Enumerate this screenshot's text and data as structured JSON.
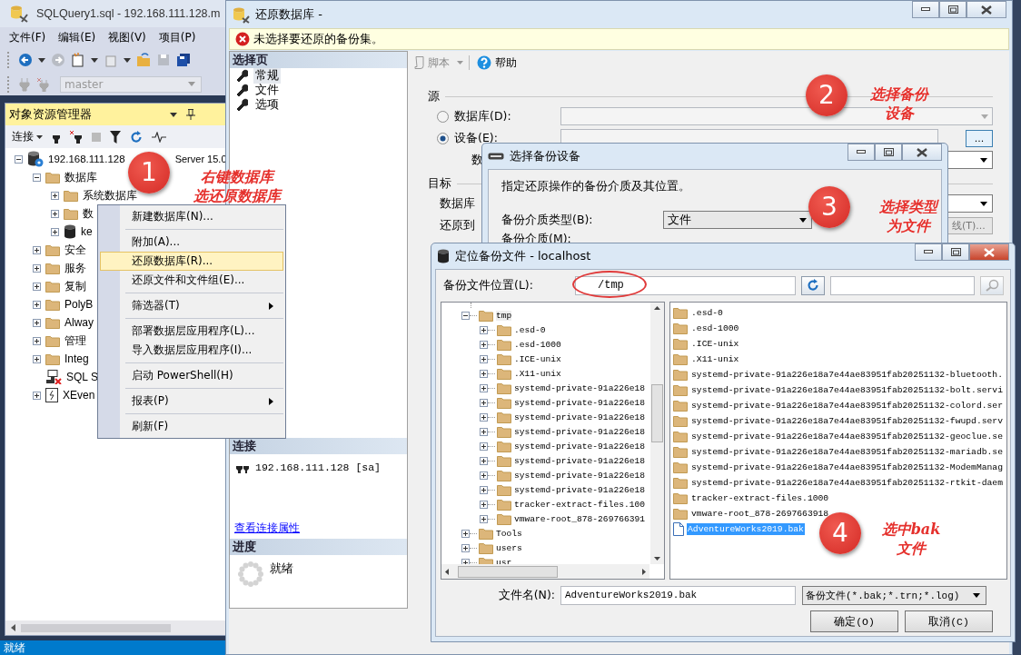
{
  "main_window": {
    "title": "SQLQuery1.sql - 192.168.111.128.m",
    "menu": [
      "文件(F)",
      "编辑(E)",
      "视图(V)",
      "项目(P)"
    ],
    "database_selector": {
      "value": "master",
      "disabled": true
    },
    "status_bar": "就绪"
  },
  "object_explorer": {
    "title": "对象资源管理器",
    "connect_label": "连接",
    "tree": [
      {
        "label": "192.168.111.128",
        "suffix": "Server 15.0",
        "kind": "server",
        "expanded": true,
        "children": [
          {
            "label": "数据库",
            "kind": "folder",
            "expanded": true,
            "children": [
              {
                "label": "系统数据库",
                "kind": "folder",
                "expanded": false
              },
              {
                "label": "数",
                "kind": "folder",
                "expanded": false
              },
              {
                "label": "ke",
                "kind": "database",
                "expanded": false
              }
            ]
          },
          {
            "label": "安全",
            "kind": "folder",
            "expanded": false
          },
          {
            "label": "服务",
            "kind": "folder",
            "expanded": false
          },
          {
            "label": "复制",
            "kind": "folder",
            "expanded": false
          },
          {
            "label": "PolyB",
            "kind": "folder",
            "expanded": false
          },
          {
            "label": "Alway",
            "kind": "folder",
            "expanded": false
          },
          {
            "label": "管理",
            "kind": "folder",
            "expanded": false
          },
          {
            "label": "Integ",
            "kind": "folder",
            "expanded": false
          },
          {
            "label": "SQL S",
            "kind": "agent"
          },
          {
            "label": "XEven",
            "kind": "xevent",
            "expanded": false
          }
        ]
      }
    ]
  },
  "context_menu": {
    "groups": [
      [
        {
          "label": "新建数据库(N)...",
          "kind": "command",
          "selected": false
        }
      ],
      [
        {
          "label": "附加(A)...",
          "kind": "command",
          "selected": false
        },
        {
          "label": "还原数据库(R)...",
          "kind": "command",
          "selected": true
        },
        {
          "label": "还原文件和文件组(E)...",
          "kind": "command",
          "selected": false
        }
      ],
      [
        {
          "label": "筛选器(T)",
          "kind": "submenu",
          "selected": false
        }
      ],
      [
        {
          "label": "部署数据层应用程序(L)...",
          "kind": "command",
          "selected": false
        },
        {
          "label": "导入数据层应用程序(I)...",
          "kind": "command",
          "selected": false
        }
      ],
      [
        {
          "label": "启动 PowerShell(H)",
          "kind": "command",
          "selected": false
        }
      ],
      [
        {
          "label": "报表(P)",
          "kind": "submenu",
          "selected": false
        }
      ],
      [
        {
          "label": "刷新(F)",
          "kind": "command",
          "selected": false
        }
      ]
    ]
  },
  "restore_dialog": {
    "title": "还原数据库 -",
    "warning": "未选择要还原的备份集。",
    "pages_header": "选择页",
    "pages": [
      {
        "label": "常规",
        "selected": true
      },
      {
        "label": "文件",
        "selected": false
      },
      {
        "label": "选项",
        "selected": false
      }
    ],
    "connection_header": "连接",
    "connection": "192.168.111.128 [sa]",
    "connection_link": "查看连接属性",
    "progress_header": "进度",
    "progress_status": "就绪",
    "toolbar": {
      "script": "脚本",
      "help": "帮助"
    },
    "source": {
      "title": "源",
      "options": [
        {
          "label": "数据库(D):",
          "selected": false
        },
        {
          "label": "设备(E):",
          "selected": true
        }
      ],
      "browse_button": "...",
      "database_label": "数"
    },
    "target": {
      "title": "目标",
      "database_label": "数据库",
      "restore_to_label": "还原到",
      "timeline_button": "线(T)..."
    }
  },
  "device_dialog": {
    "title": "选择备份设备",
    "description": "指定还原操作的备份介质及其位置。",
    "media_type_label": "备份介质类型(B):",
    "media_type": "文件",
    "media_label": "备份介质(M):"
  },
  "locate_dialog": {
    "title": "定位备份文件 - localhost",
    "location_label": "备份文件位置(L):",
    "location": "/tmp",
    "folder_tree": [
      {
        "label": "tmp",
        "expanded": true,
        "selected": true,
        "children": [
          {
            "label": ".esd-0",
            "expanded": false,
            "selected": false
          },
          {
            "label": ".esd-1000",
            "expanded": false,
            "selected": false
          },
          {
            "label": ".ICE-unix",
            "expanded": false,
            "selected": false
          },
          {
            "label": ".X11-unix",
            "expanded": false,
            "selected": false
          },
          {
            "label": "systemd-private-91a226e18",
            "expanded": false,
            "selected": false
          },
          {
            "label": "systemd-private-91a226e18",
            "expanded": false,
            "selected": false
          },
          {
            "label": "systemd-private-91a226e18",
            "expanded": false,
            "selected": false
          },
          {
            "label": "systemd-private-91a226e18",
            "expanded": false,
            "selected": false
          },
          {
            "label": "systemd-private-91a226e18",
            "expanded": false,
            "selected": false
          },
          {
            "label": "systemd-private-91a226e18",
            "expanded": false,
            "selected": false
          },
          {
            "label": "systemd-private-91a226e18",
            "expanded": false,
            "selected": false
          },
          {
            "label": "systemd-private-91a226e18",
            "expanded": false,
            "selected": false
          },
          {
            "label": "tracker-extract-files.100",
            "expanded": false,
            "selected": false
          },
          {
            "label": "vmware-root_878-269766391",
            "expanded": false,
            "selected": false
          }
        ]
      },
      {
        "label": "Tools",
        "expanded": false,
        "selected": false
      },
      {
        "label": "users",
        "expanded": false,
        "selected": false
      },
      {
        "label": "usr",
        "expanded": false,
        "selected": false
      }
    ],
    "files": [
      {
        "name": ".esd-0",
        "kind": "folder",
        "selected": false
      },
      {
        "name": ".esd-1000",
        "kind": "folder",
        "selected": false
      },
      {
        "name": ".ICE-unix",
        "kind": "folder",
        "selected": false
      },
      {
        "name": ".X11-unix",
        "kind": "folder",
        "selected": false
      },
      {
        "name": "systemd-private-91a226e18a7e44ae83951fab20251132-bluetooth.",
        "kind": "folder",
        "selected": false
      },
      {
        "name": "systemd-private-91a226e18a7e44ae83951fab20251132-bolt.servi",
        "kind": "folder",
        "selected": false
      },
      {
        "name": "systemd-private-91a226e18a7e44ae83951fab20251132-colord.ser",
        "kind": "folder",
        "selected": false
      },
      {
        "name": "systemd-private-91a226e18a7e44ae83951fab20251132-fwupd.serv",
        "kind": "folder",
        "selected": false
      },
      {
        "name": "systemd-private-91a226e18a7e44ae83951fab20251132-geoclue.se",
        "kind": "folder",
        "selected": false
      },
      {
        "name": "systemd-private-91a226e18a7e44ae83951fab20251132-mariadb.se",
        "kind": "folder",
        "selected": false
      },
      {
        "name": "systemd-private-91a226e18a7e44ae83951fab20251132-ModemManag",
        "kind": "folder",
        "selected": false
      },
      {
        "name": "systemd-private-91a226e18a7e44ae83951fab20251132-rtkit-daem",
        "kind": "folder",
        "selected": false
      },
      {
        "name": "tracker-extract-files.1000",
        "kind": "folder",
        "selected": false
      },
      {
        "name": "vmware-root_878-2697663918",
        "kind": "folder",
        "selected": false
      },
      {
        "name": "AdventureWorks2019.bak",
        "kind": "file",
        "selected": true
      }
    ],
    "file_name_label": "文件名(N):",
    "file_name": "AdventureWorks2019.bak",
    "file_type": "备份文件(*.bak;*.trn;*.log)",
    "buttons": [
      "确定(O)",
      "取消(C)"
    ]
  },
  "annotations": [
    {
      "number": "1",
      "lines": [
        "右键数据库",
        "选还原数据库"
      ]
    },
    {
      "number": "2",
      "lines": [
        "选择备份",
        "设备"
      ]
    },
    {
      "number": "3",
      "lines": [
        "选择类型",
        "为文件"
      ]
    },
    {
      "number": "4",
      "lines": [
        "选中bak",
        "文件"
      ]
    }
  ]
}
